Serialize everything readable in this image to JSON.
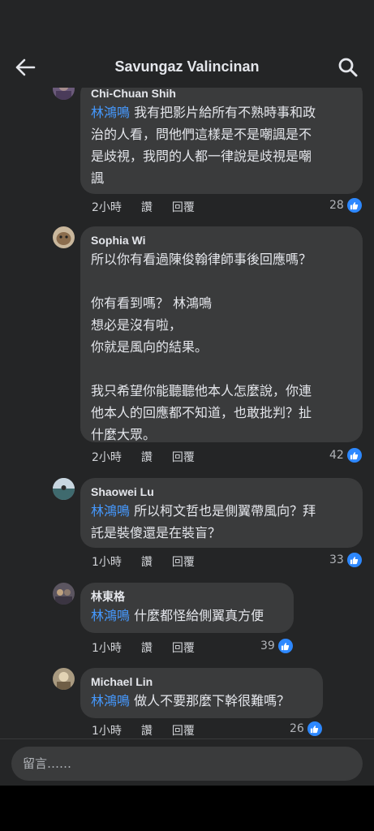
{
  "header": {
    "title": "Savungaz Valincinan"
  },
  "comments": [
    {
      "author": "Chi-Chuan Shih",
      "mention": "林鴻鳴",
      "text": " 我有把影片給所有不熟時事和政\n治的人看，問他們這樣是不是嘲諷是不\n是歧視，我問的人都一律說是歧視是嘲\n諷",
      "time": "2小時",
      "like": "讚",
      "reply": "回覆",
      "count": "28"
    },
    {
      "author": "Sophia Wi",
      "mention": "",
      "text": "所以你有看過陳俊翰律師事後回應嗎？\n\n你有看到嗎？ 林鴻鳴\n想必是沒有啦，\n你就是風向的結果。\n\n我只希望你能聽聽他本人怎麼說，你連\n他本人的回應都不知道，也敢批判？扯\n什麼大眾。",
      "time": "2小時",
      "like": "讚",
      "reply": "回覆",
      "count": "42"
    },
    {
      "author": "Shaowei Lu",
      "mention": "林鴻鳴",
      "text": " 所以柯文哲也是側翼帶風向？拜\n託是裝傻還是在裝盲？",
      "time": "1小時",
      "like": "讚",
      "reply": "回覆",
      "count": "33"
    },
    {
      "author": "林東格",
      "mention": "林鴻鳴",
      "text": " 什麼都怪給側翼真方便",
      "time": "1小時",
      "like": "讚",
      "reply": "回覆",
      "count": "39"
    },
    {
      "author": "Michael Lin",
      "mention": "林鴻鳴",
      "text": " 做人不要那麼下幹很難嗎？",
      "time": "1小時",
      "like": "讚",
      "reply": "回覆",
      "count": "26"
    }
  ],
  "composer": {
    "placeholder": "留言……"
  },
  "colors": {
    "background": "#242526",
    "bubble": "#3a3b3c",
    "mention": "#4599ff",
    "like": "#2d88ff"
  }
}
